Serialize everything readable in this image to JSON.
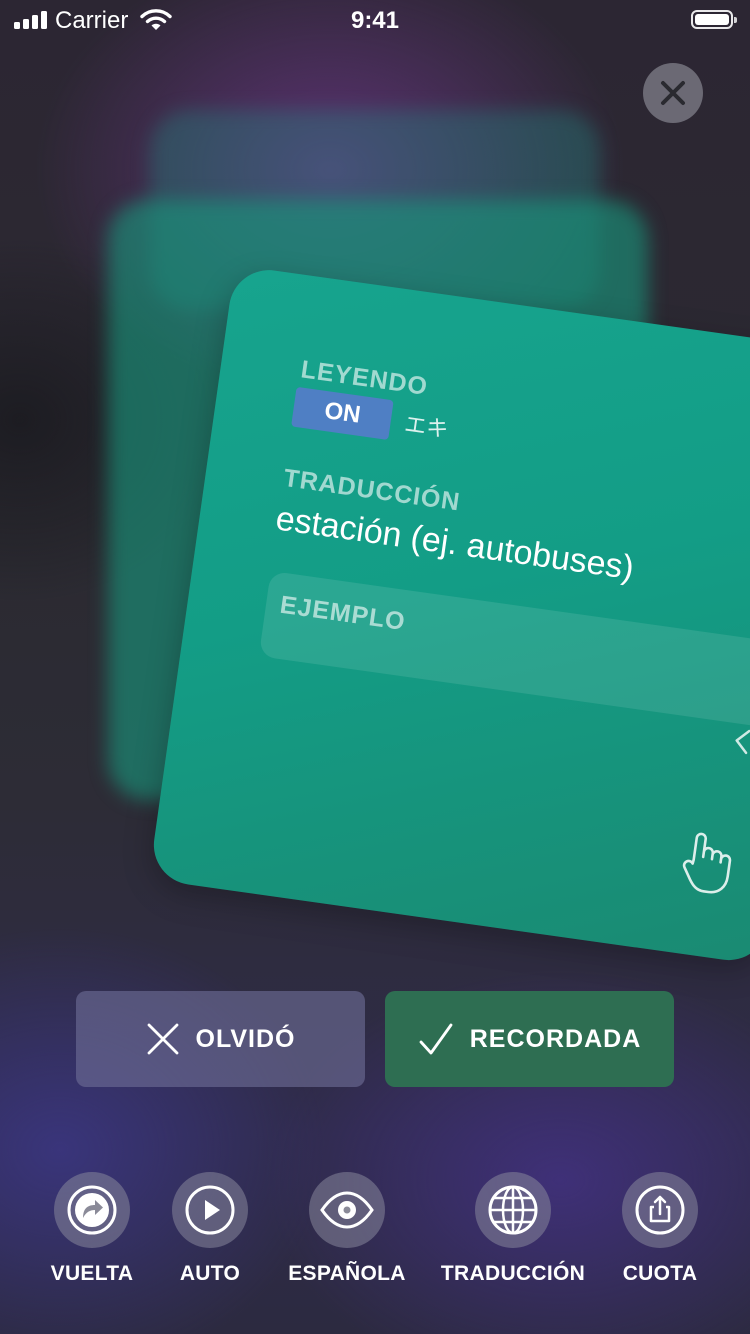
{
  "status_bar": {
    "carrier": "Carrier",
    "time": "9:41"
  },
  "card": {
    "reading_label": "LEYENDO",
    "reading_toggle": "ON",
    "reading_value": "エキ",
    "translation_label": "TRADUCCIÓN",
    "translation_value": "estación (ej. autobuses)",
    "example_label": "EJEMPLO"
  },
  "actions": {
    "forgot_label": "OLVIDÓ",
    "remembered_label": "RECORDADA"
  },
  "toolbar": {
    "items": [
      {
        "label": "VUELTA",
        "icon": "flip-arrow-icon"
      },
      {
        "label": "AUTO",
        "icon": "play-icon"
      },
      {
        "label": "ESPAÑOLA",
        "icon": "eye-icon"
      },
      {
        "label": "TRADUCCIÓN",
        "icon": "globe-icon"
      },
      {
        "label": "CUOTA",
        "icon": "share-icon"
      }
    ]
  },
  "colors": {
    "card": "#17a48e",
    "toggle_on": "#4f7fc4",
    "remembered_button": "#2e6e52",
    "forgot_button": "#6e6e96"
  }
}
